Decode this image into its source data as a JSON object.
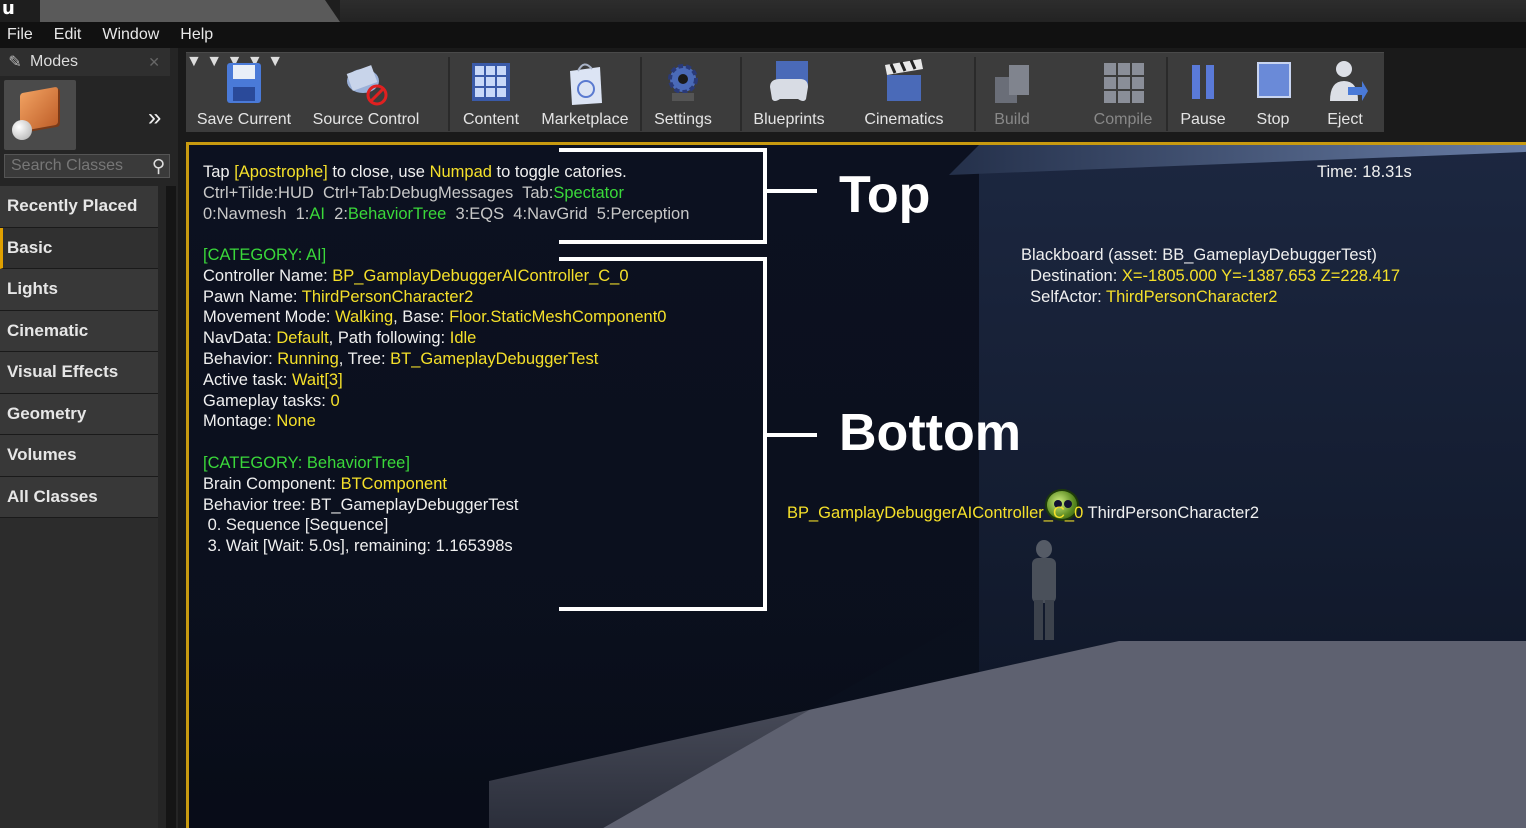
{
  "menu": [
    "File",
    "Edit",
    "Window",
    "Help"
  ],
  "modes": {
    "title": "Modes",
    "search_placeholder": "Search Classes",
    "categories": [
      "Recently Placed",
      "Basic",
      "Lights",
      "Cinematic",
      "Visual Effects",
      "Geometry",
      "Volumes",
      "All Classes"
    ],
    "active_category": "Basic"
  },
  "toolbar": {
    "buttons": [
      "Save Current",
      "Source Control",
      "Content",
      "Marketplace",
      "Settings",
      "Blueprints",
      "Cinematics",
      "Build",
      "Compile",
      "Pause",
      "Stop",
      "Eject"
    ],
    "disabled": [
      "Build",
      "Compile"
    ]
  },
  "hud": {
    "time": "Time: 18.31s",
    "header": {
      "line1": [
        "Tap ",
        "[Apostrophe]",
        " to close, use ",
        "Numpad",
        " to toggle catories."
      ],
      "line2": [
        "Ctrl+Tilde:HUD  Ctrl+Tab:DebugMessages  Tab:",
        "Spectator"
      ],
      "line3": [
        "0:Navmesh  1:",
        "AI",
        "  2:",
        "BehaviorTree",
        "  3:EQS  4:NavGrid  5:Perception"
      ]
    },
    "ai": {
      "category": "[CATEGORY: AI]",
      "controller_label": "Controller Name: ",
      "controller": "BP_GamplayDebuggerAIController_C_0",
      "pawn_label": "Pawn Name: ",
      "pawn": "ThirdPersonCharacter2",
      "movement_label": "Movement Mode: ",
      "movement": "Walking",
      "base_label": ", Base: ",
      "base": "Floor.StaticMeshComponent0",
      "navdata_label": "NavData: ",
      "navdata": "Default",
      "path_label": ", Path following: ",
      "path": "Idle",
      "behavior_label": "Behavior: ",
      "behavior": "Running",
      "tree_label": ", Tree: ",
      "tree": "BT_GameplayDebuggerTest",
      "active_label": "Active task: ",
      "active": "Wait[3]",
      "tasks_label": "Gameplay tasks: ",
      "tasks": "0",
      "montage_label": "Montage: ",
      "montage": "None"
    },
    "bt": {
      "category": "[CATEGORY: BehaviorTree]",
      "brain_label": "Brain Component: ",
      "brain": "BTComponent",
      "tree_line": "Behavior tree: BT_GameplayDebuggerTest",
      "node0": " 0. Sequence [Sequence]",
      "node3": " 3. Wait [Wait: 5.0s], remaining: 1.165398s"
    },
    "blackboard": {
      "title": "Blackboard (asset: BB_GameplayDebuggerTest)",
      "dest_label": "  Destination: ",
      "dest": "X=-1805.000 Y=-1387.653 Z=228.417",
      "self_label": "  SelfActor: ",
      "self": "ThirdPersonCharacter2"
    },
    "actor_controller": "BP_GamplayDebuggerAIController_C_0",
    "actor_pawn": " ThirdPersonCharacter2"
  },
  "annotations": {
    "top": "Top",
    "bottom": "Bottom"
  }
}
